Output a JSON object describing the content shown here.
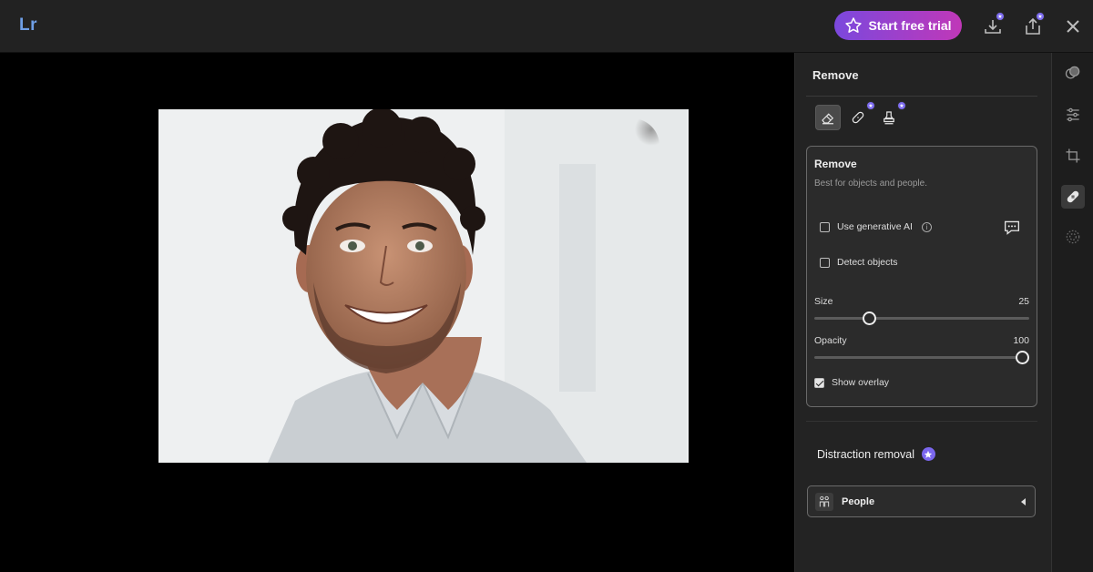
{
  "app": {
    "logo": "Lr"
  },
  "header": {
    "trial_label": "Start free trial"
  },
  "panel": {
    "title": "Remove",
    "card": {
      "title": "Remove",
      "description": "Best for objects and people.",
      "generative_ai_label": "Use generative AI",
      "generative_ai_checked": false,
      "detect_objects_label": "Detect objects",
      "detect_objects_checked": false,
      "size_label": "Size",
      "size_value": "25",
      "opacity_label": "Opacity",
      "opacity_value": "100",
      "show_overlay_label": "Show overlay",
      "show_overlay_checked": true
    },
    "distraction": {
      "title": "Distraction removal",
      "people_label": "People"
    }
  },
  "colors": {
    "accent_gradient_start": "#7b48dd",
    "accent_gradient_end": "#c038b8",
    "premium_badge": "#7d6cf0",
    "logo": "#6f9fe6"
  },
  "icons": {
    "top": [
      "star-icon",
      "download-icon",
      "share-icon",
      "close-icon"
    ],
    "tools": [
      "eraser-icon",
      "bandage-icon",
      "stamp-icon"
    ],
    "rail": [
      "presets-icon",
      "adjust-sliders-icon",
      "crop-icon",
      "heal-icon",
      "masking-icon"
    ]
  }
}
